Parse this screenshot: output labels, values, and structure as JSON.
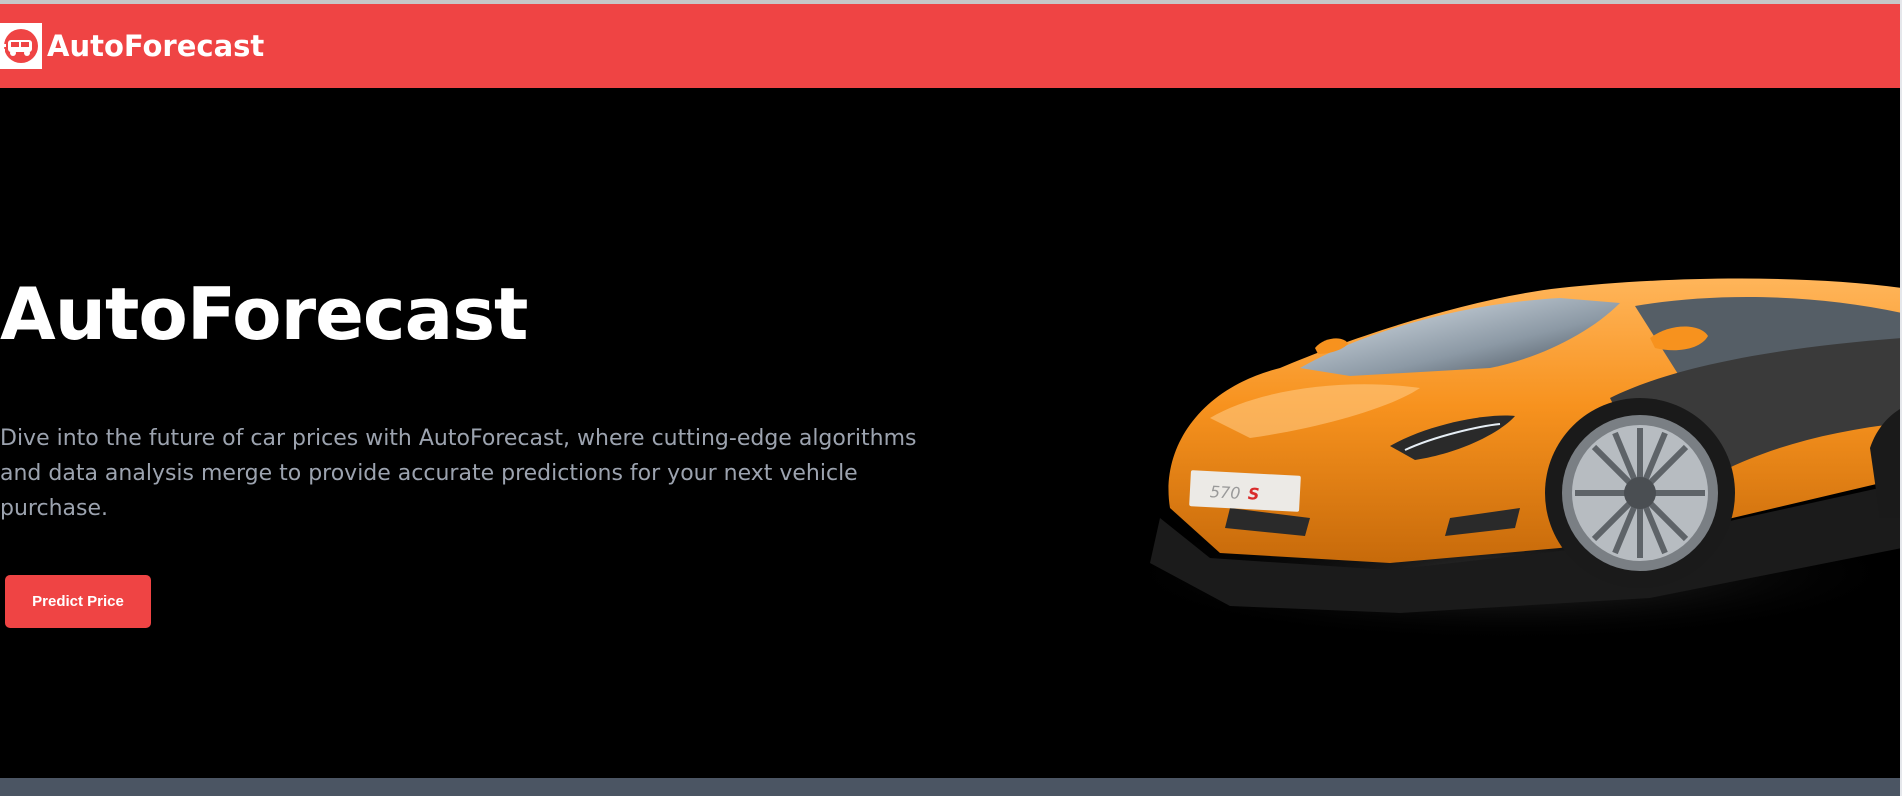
{
  "navbar": {
    "brand_name": "AutoForecast",
    "logo_icon": "car-logo-icon",
    "background": "#ef4444"
  },
  "hero": {
    "title": "AutoForecast",
    "description": "Dive into the future of car prices with AutoForecast, where cutting-edge algorithms and data analysis merge to provide accurate predictions for your next vehicle purchase.",
    "button_label": "Predict Price",
    "image": "orange-sports-car",
    "car_plate_text": "570S"
  },
  "colors": {
    "accent": "#ef4444",
    "background": "#000000",
    "body_text": "#9ca3af",
    "footer": "#4b5563",
    "car_body": "#f7921e"
  }
}
